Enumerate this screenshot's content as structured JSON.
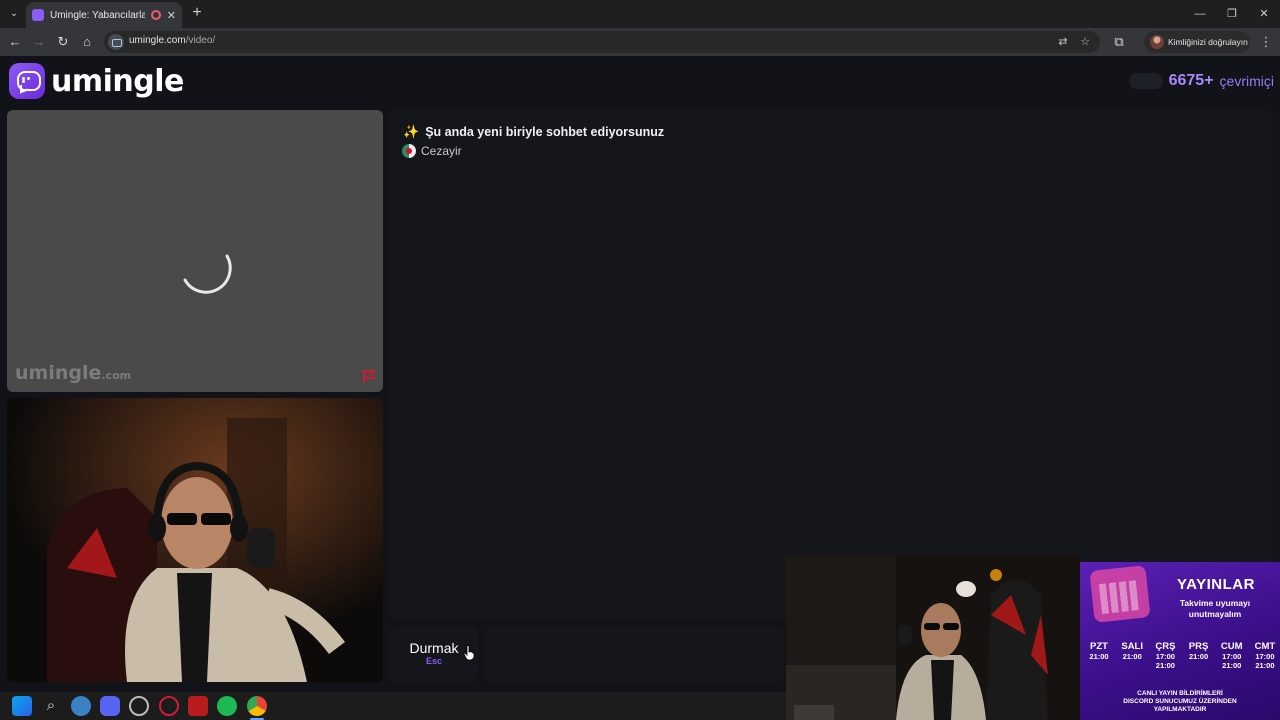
{
  "browser": {
    "tab_title": "Umingle: Yabancılarla Görü",
    "tab_close": "✕",
    "new_tab": "+",
    "url_host": "umingle.com",
    "url_path": "/video/",
    "profile_label": "Kimliğinizi doğrulayın",
    "window_controls": [
      "—",
      "❐",
      "✕"
    ]
  },
  "site": {
    "logo_text": "umingle",
    "online_count": "6675+",
    "online_label": "çevrimiçi"
  },
  "stranger_video": {
    "watermark_main": "umingle",
    "watermark_suffix": ".com"
  },
  "chat": {
    "sparkle": "✨",
    "status_message": "Şu anda yeni biriyle sohbet ediyorsunuz",
    "country": "Cezayir"
  },
  "controls": {
    "stop_label": "Durmak",
    "stop_key": "Esc"
  },
  "schedule_overlay": {
    "title": "YAYINLAR",
    "subtitle_line1": "Takvime uyumayı",
    "subtitle_line2": "unutmayalım",
    "days": [
      {
        "name": "PZT",
        "times": [
          "21:00"
        ]
      },
      {
        "name": "SALI",
        "times": [
          "21:00"
        ]
      },
      {
        "name": "ÇRŞ",
        "times": [
          "17:00",
          "21:00"
        ]
      },
      {
        "name": "PRŞ",
        "times": [
          "21:00"
        ]
      },
      {
        "name": "CUM",
        "times": [
          "17:00",
          "21:00"
        ]
      },
      {
        "name": "CMT",
        "times": [
          "17:00",
          "21:00"
        ]
      }
    ],
    "footer_line1": "CANLI YAYIN BİLDİRİMLERİ",
    "footer_line2": "DISCORD SUNUCUMUZ ÜZERİNDEN",
    "footer_line3": "YAPILMAKTADIR"
  },
  "colors": {
    "accent": "#8b5cf6",
    "online_accent": "#a78bfa"
  }
}
